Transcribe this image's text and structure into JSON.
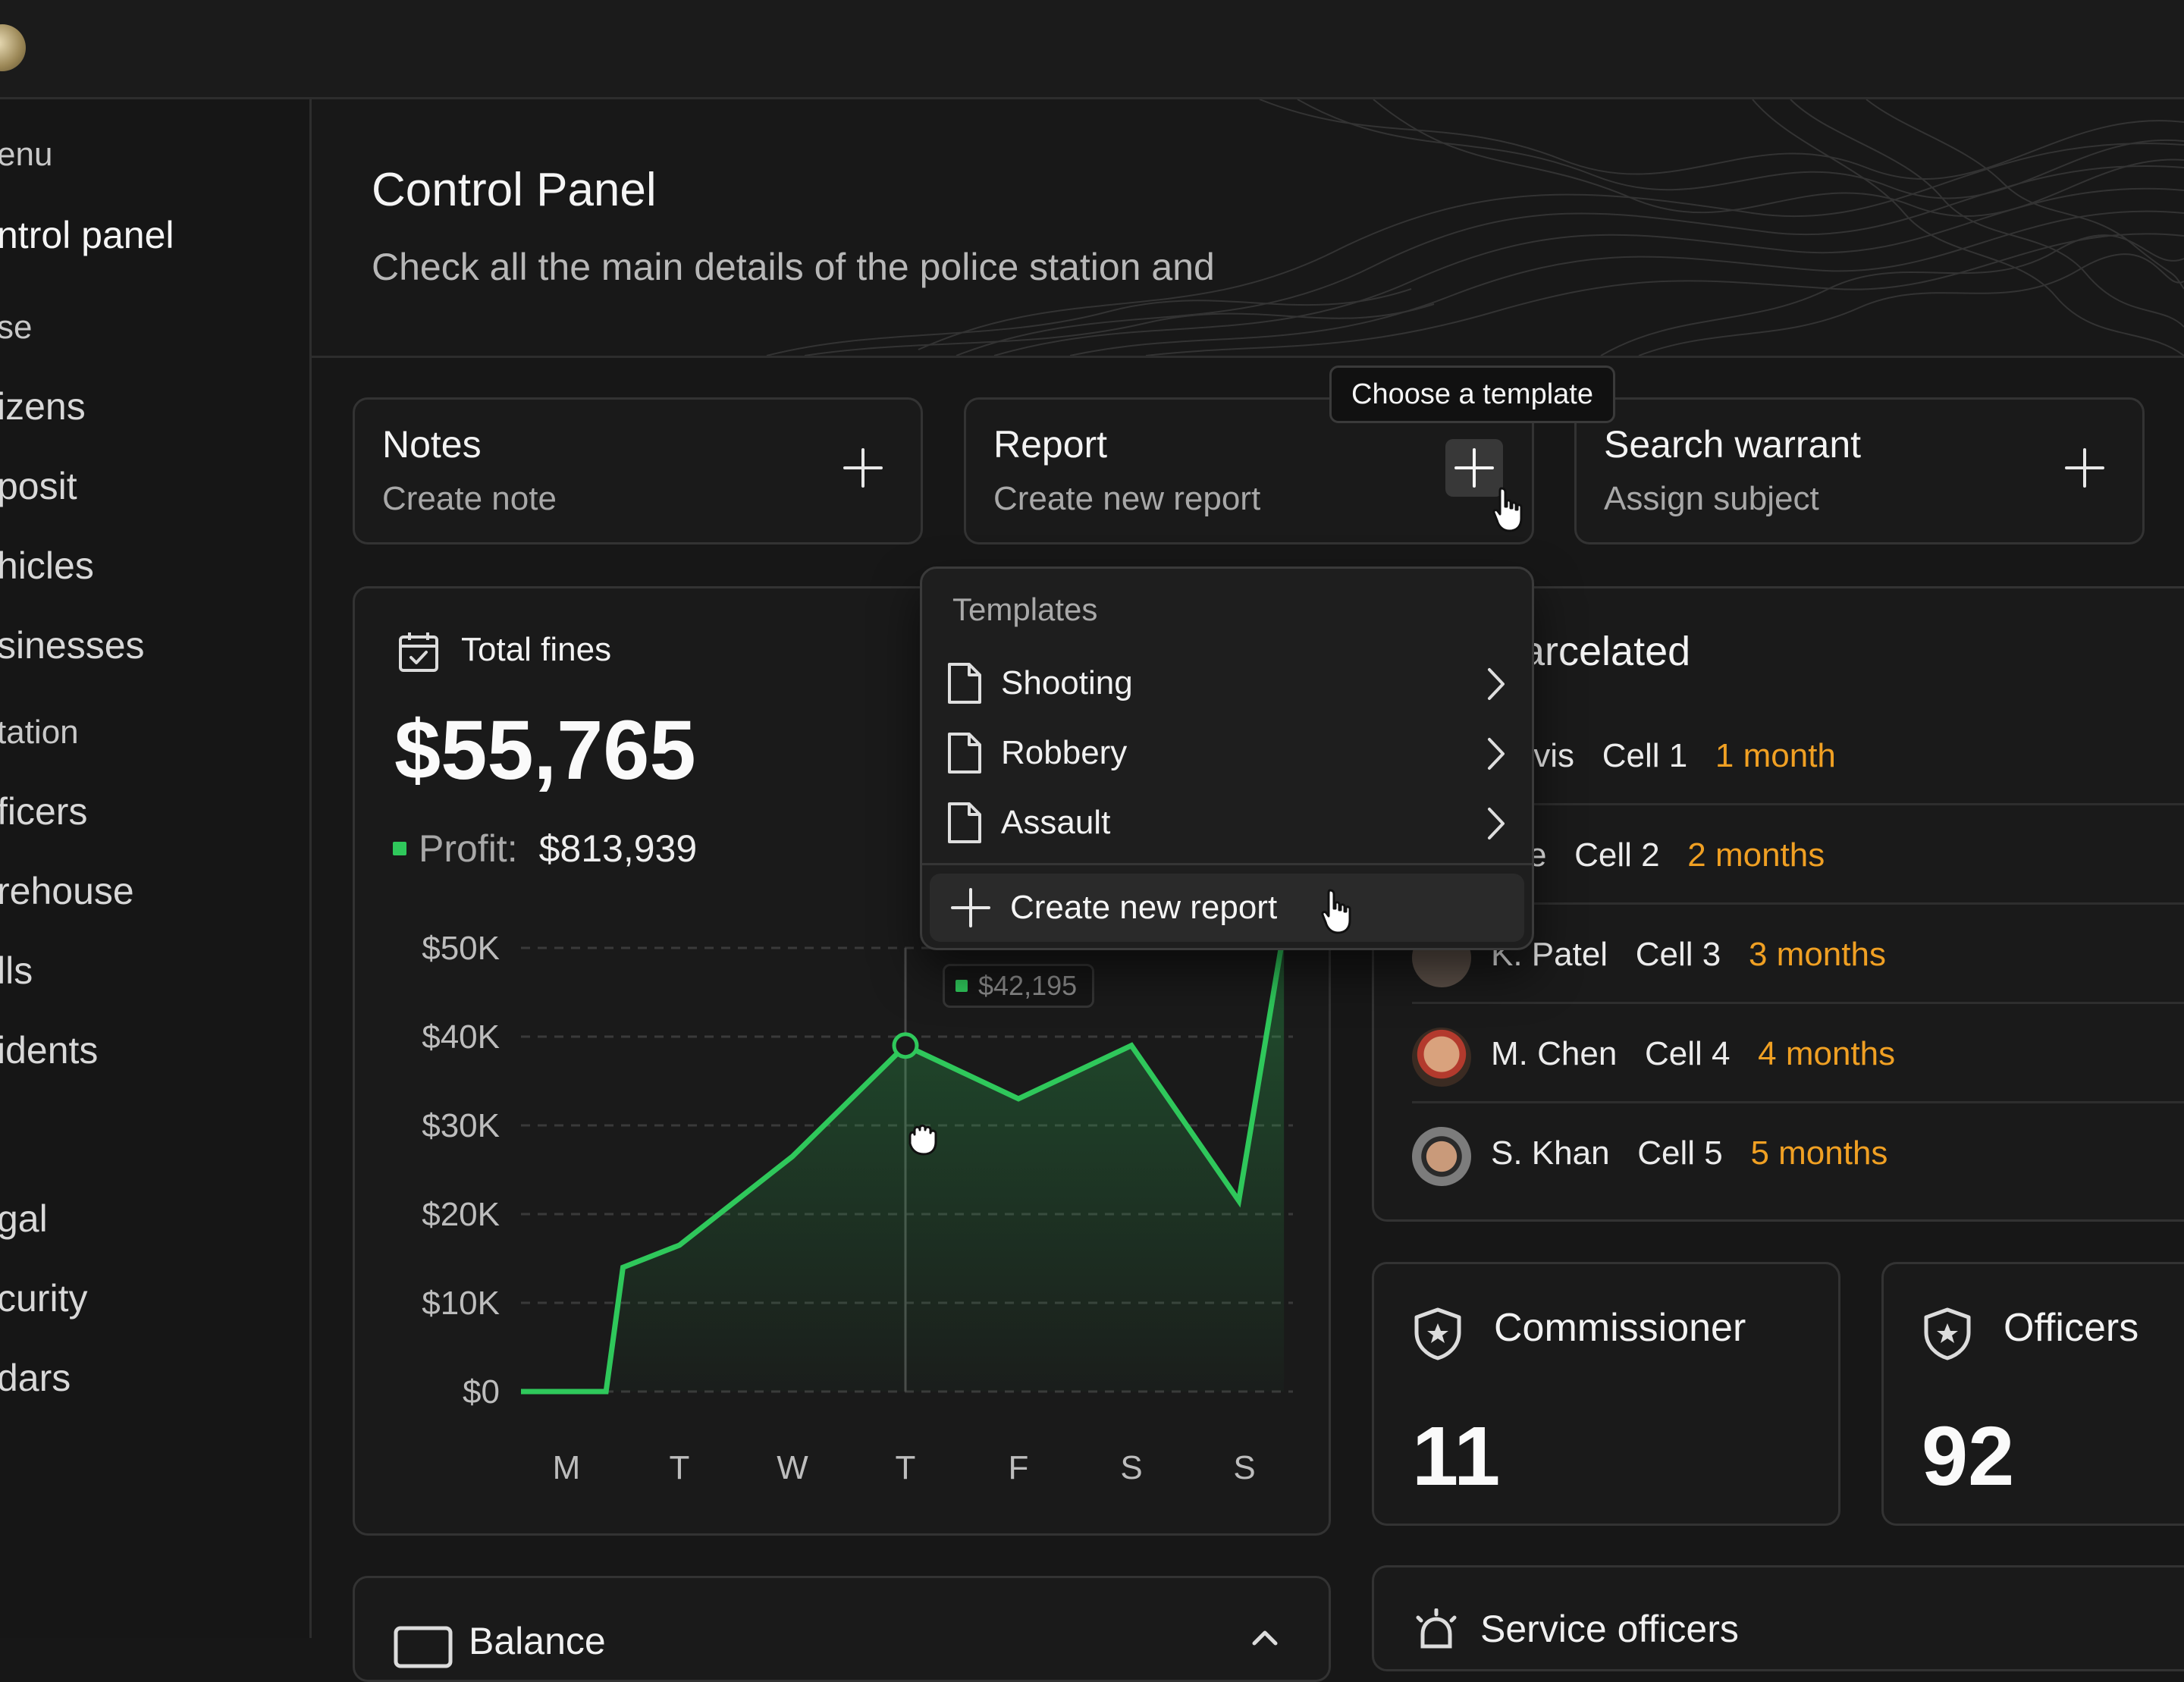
{
  "sidebar": {
    "items": [
      {
        "label": "enu"
      },
      {
        "label": "ntrol panel"
      },
      {
        "label": "se"
      },
      {
        "label": "izens"
      },
      {
        "label": "posit"
      },
      {
        "label": "hicles"
      },
      {
        "label": "sinesses"
      },
      {
        "label": "tation"
      },
      {
        "label": "ficers"
      },
      {
        "label": "rehouse"
      },
      {
        "label": "lls"
      },
      {
        "label": "idents"
      },
      {
        "label": "gal"
      },
      {
        "label": "curity"
      },
      {
        "label": "dars"
      }
    ]
  },
  "header": {
    "title": "Control Panel",
    "subtitle": "Check all the main details of the police station and"
  },
  "quick_actions": [
    {
      "title": "Notes",
      "subtitle": "Create note"
    },
    {
      "title": "Report",
      "subtitle": "Create new report"
    },
    {
      "title": "Search warrant",
      "subtitle": "Assign subject"
    }
  ],
  "tooltip": "Choose a template",
  "templates_menu": {
    "heading": "Templates",
    "items": [
      {
        "label": "Shooting"
      },
      {
        "label": "Robbery"
      },
      {
        "label": "Assault"
      }
    ],
    "create_label": "Create new report"
  },
  "fines": {
    "title": "Total fines",
    "value": "$55,765",
    "profit_label": "Profit:",
    "profit_value": "$813,939",
    "tooltip_value": "$42,195"
  },
  "chart_data": {
    "type": "area",
    "categories": [
      "M",
      "T",
      "W",
      "T",
      "F",
      "S",
      "S"
    ],
    "x": [
      "M",
      "",
      "",
      "T",
      "",
      "W",
      "",
      "T",
      "",
      "F",
      "",
      "S",
      "",
      "S",
      ""
    ],
    "series": [
      {
        "values": [
          0,
          0,
          14000,
          16500,
          26500,
          39000,
          33000,
          39000,
          21500,
          52000
        ]
      }
    ],
    "x_positions": [
      0,
      0.35,
      0.5,
      1.0,
      2.0,
      3.0,
      4.0,
      5.0,
      5.95,
      6.35
    ],
    "y_ticks": [
      "$0",
      "$10K",
      "$20K",
      "$30K",
      "$40K",
      "$50K"
    ],
    "ylim": [
      0,
      50000
    ],
    "highlight_index": 5,
    "grid": true,
    "colors": {
      "line": "#2fc85b",
      "fill": "#2fc85b"
    }
  },
  "incarcerated": {
    "title": "arcelated",
    "rows": [
      {
        "name": "Davis",
        "cell": "Cell 1",
        "duration": "1 month"
      },
      {
        "name": "Lee",
        "cell": "Cell 2",
        "duration": "2 months"
      },
      {
        "name": "K. Patel",
        "cell": "Cell 3",
        "duration": "3 months"
      },
      {
        "name": "M. Chen",
        "cell": "Cell 4",
        "duration": "4 months"
      },
      {
        "name": "S. Khan",
        "cell": "Cell 5",
        "duration": "5 months"
      }
    ]
  },
  "stats": [
    {
      "title": "Commissioner",
      "value": "11"
    },
    {
      "title": "Officers",
      "value": "92"
    }
  ],
  "bottom": {
    "balance_label": "Balance",
    "service_officers_label": "Service officers"
  },
  "colors": {
    "accent_green": "#2fc85b",
    "duration_orange": "#f0a023",
    "background": "#171717"
  }
}
